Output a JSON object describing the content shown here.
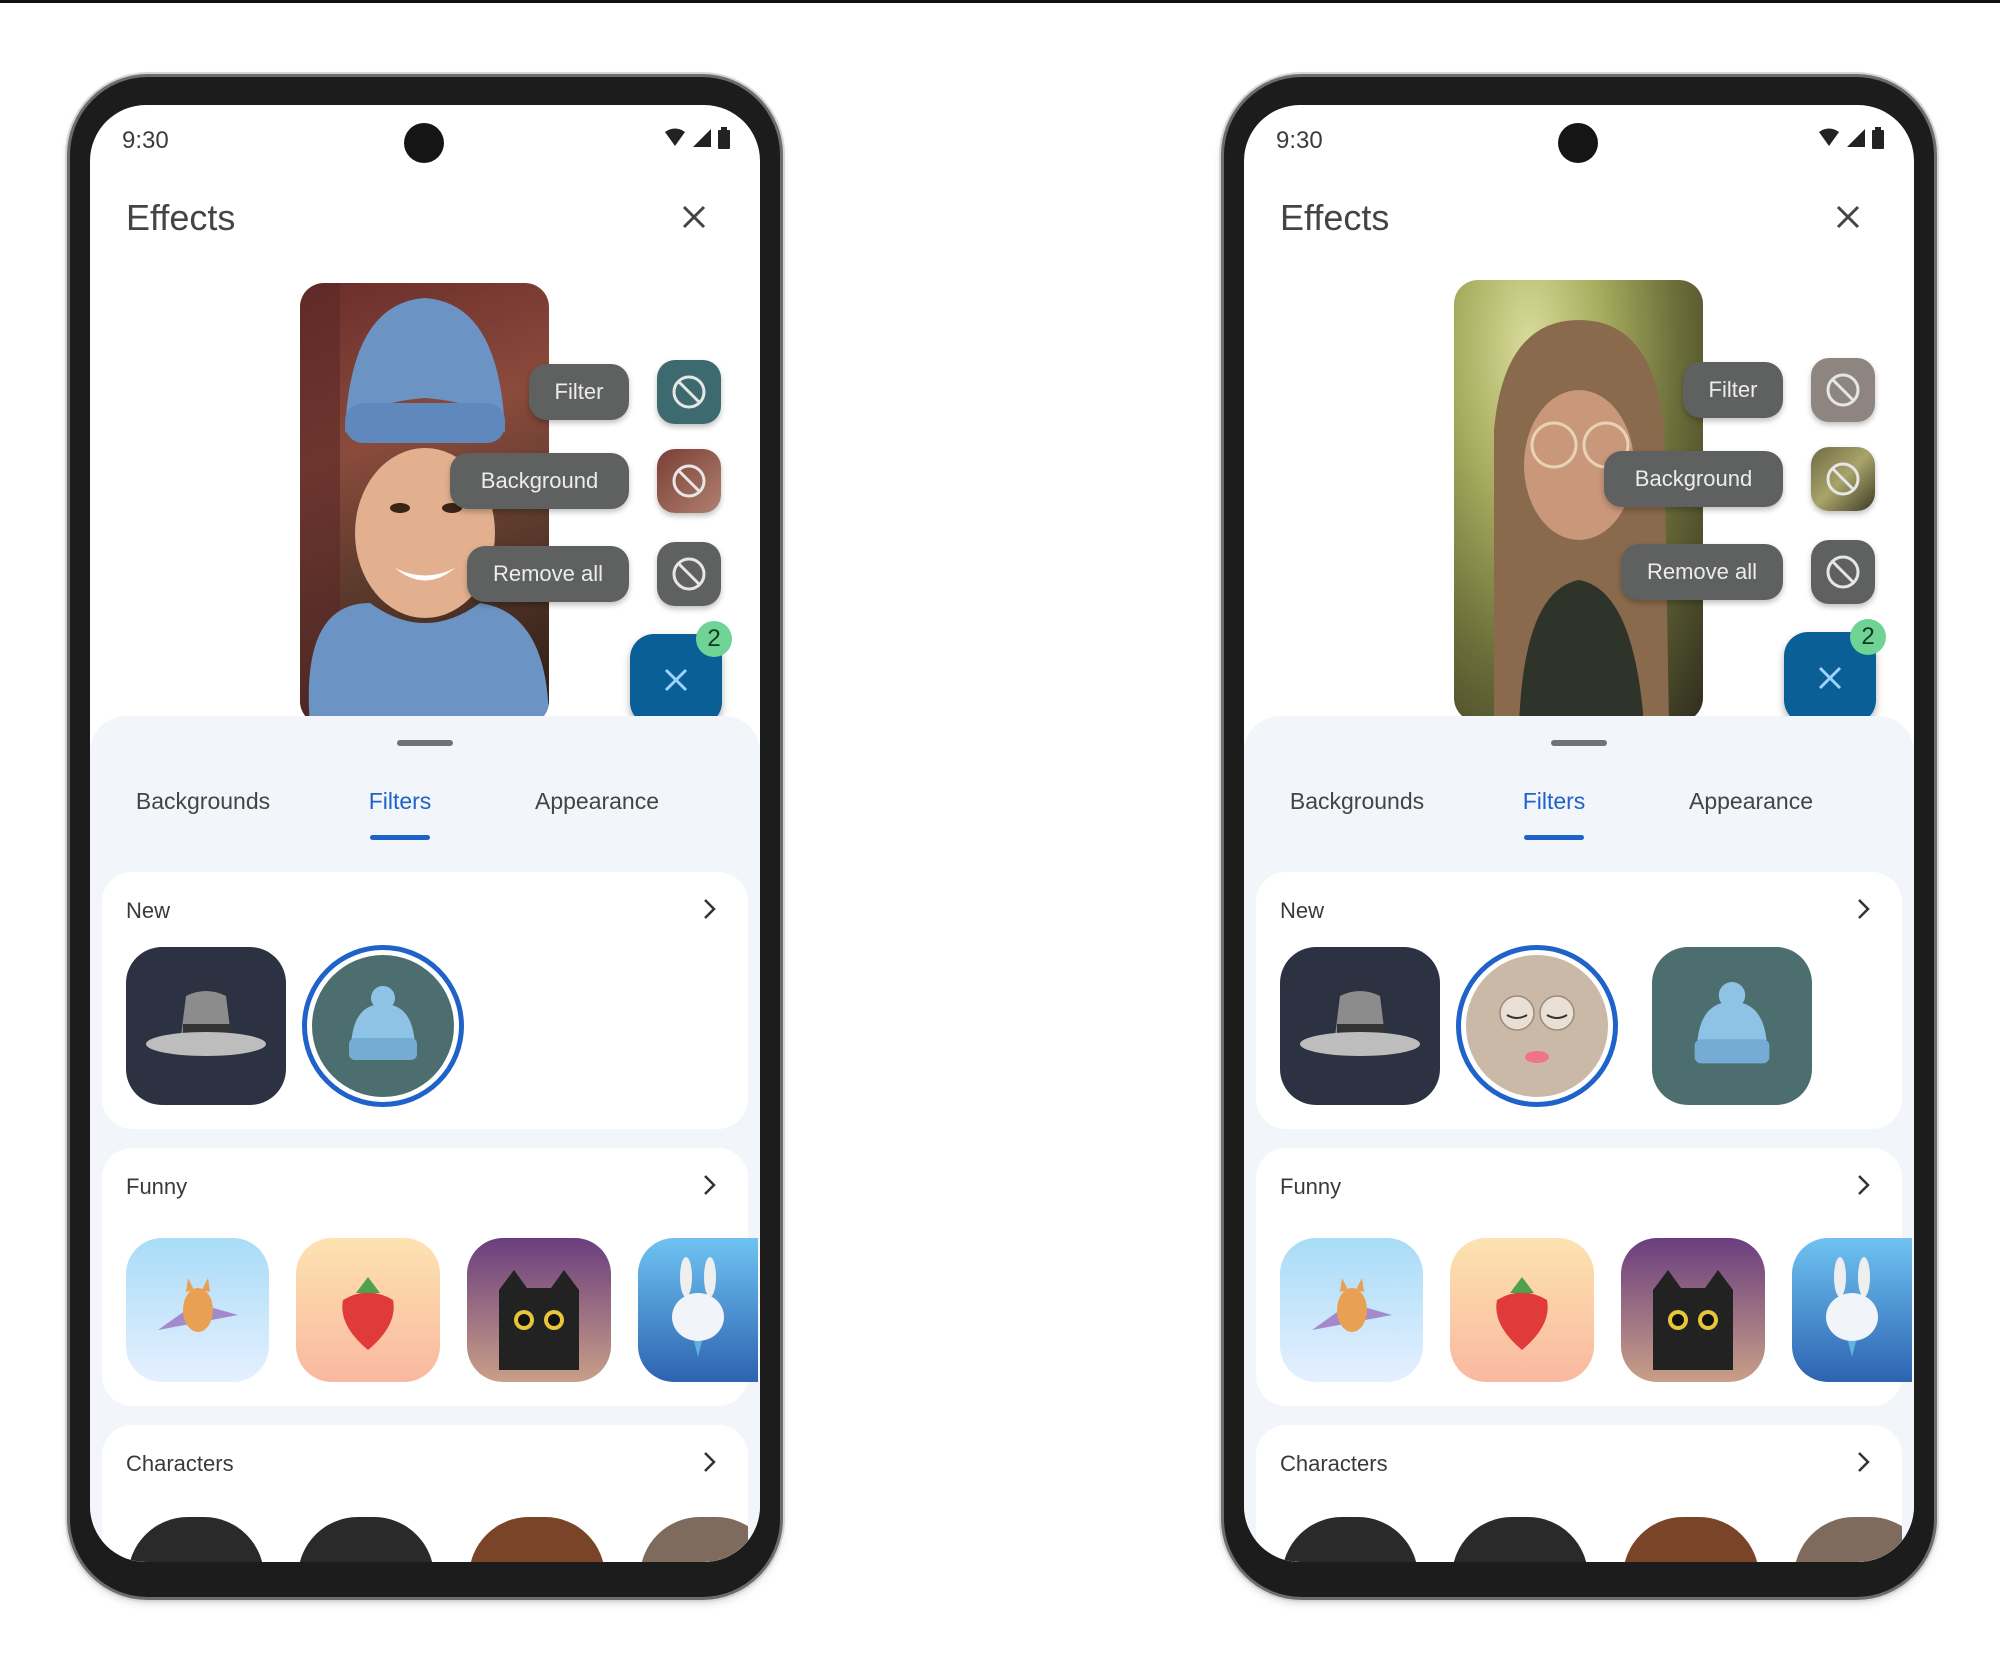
{
  "screens": [
    {
      "status": {
        "time": "9:30",
        "icons": [
          "wifi-icon",
          "signal-icon",
          "battery-icon"
        ]
      },
      "header": {
        "title": "Effects",
        "close_icon": "close-icon"
      },
      "preview": {
        "subject": "woman in blue knit beanie and scarf"
      },
      "effect_actions": [
        {
          "label": "Filter",
          "icon": "no-effect-icon",
          "thumb": "beanie-filter"
        },
        {
          "label": "Background",
          "icon": "no-effect-icon",
          "thumb": "room-background"
        },
        {
          "label": "Remove all",
          "icon": "no-effect-icon",
          "thumb": "none"
        }
      ],
      "fab": {
        "icon": "close-icon",
        "badge_count": "2"
      },
      "tabs": [
        {
          "label": "Backgrounds",
          "active": false
        },
        {
          "label": "Filters",
          "active": true
        },
        {
          "label": "Appearance",
          "active": false
        }
      ],
      "sections": [
        {
          "label": "New",
          "items": [
            {
              "name": "fedora-hat",
              "selected": false
            },
            {
              "name": "blue-beanie",
              "selected": true
            }
          ]
        },
        {
          "label": "Funny",
          "items": [
            {
              "name": "flying-fox",
              "selected": false
            },
            {
              "name": "strawberry",
              "selected": false
            },
            {
              "name": "black-cat",
              "selected": false
            },
            {
              "name": "bunny",
              "selected": false
            }
          ]
        },
        {
          "label": "Characters",
          "items": []
        }
      ]
    },
    {
      "status": {
        "time": "9:30",
        "icons": [
          "wifi-icon",
          "signal-icon",
          "battery-icon"
        ]
      },
      "header": {
        "title": "Effects",
        "close_icon": "close-icon"
      },
      "preview": {
        "subject": "woman with round glasses in forest background"
      },
      "effect_actions": [
        {
          "label": "Filter",
          "icon": "no-effect-icon",
          "thumb": "glasses-filter"
        },
        {
          "label": "Background",
          "icon": "no-effect-icon",
          "thumb": "forest-background"
        },
        {
          "label": "Remove all",
          "icon": "no-effect-icon",
          "thumb": "none"
        }
      ],
      "fab": {
        "icon": "close-icon",
        "badge_count": "2"
      },
      "tabs": [
        {
          "label": "Backgrounds",
          "active": false
        },
        {
          "label": "Filters",
          "active": true
        },
        {
          "label": "Appearance",
          "active": false
        }
      ],
      "sections": [
        {
          "label": "New",
          "items": [
            {
              "name": "fedora-hat",
              "selected": false
            },
            {
              "name": "glasses-face",
              "selected": true
            },
            {
              "name": "blue-beanie",
              "selected": false
            }
          ]
        },
        {
          "label": "Funny",
          "items": [
            {
              "name": "flying-fox",
              "selected": false
            },
            {
              "name": "strawberry",
              "selected": false
            },
            {
              "name": "black-cat",
              "selected": false
            },
            {
              "name": "bunny",
              "selected": false
            }
          ]
        },
        {
          "label": "Characters",
          "items": []
        }
      ]
    }
  ],
  "colors": {
    "accent": "#1f62c9",
    "fab": "#0a5f97",
    "badge": "#6fd395",
    "pill": "#5f6160",
    "sheet": "#f2f5f9"
  }
}
